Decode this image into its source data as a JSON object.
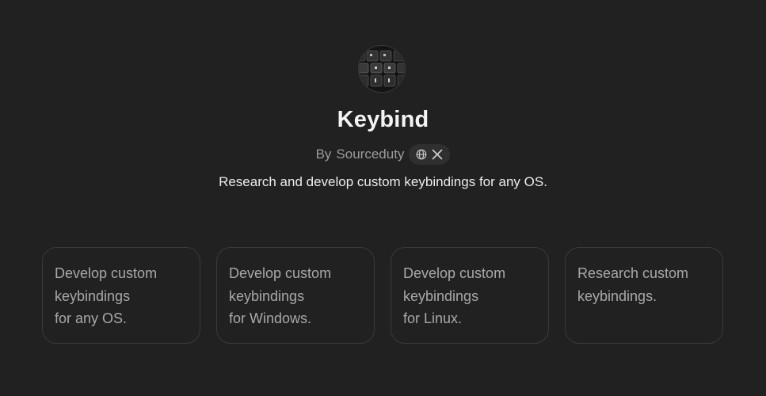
{
  "gpt": {
    "name": "Keybind",
    "author_prefix": "By",
    "author": "Sourceduty",
    "description": "Research and develop custom keybindings for any OS.",
    "links": [
      {
        "icon": "globe-icon"
      },
      {
        "icon": "x-logo-icon"
      }
    ]
  },
  "starters": [
    {
      "lines": [
        "Develop custom",
        "keybindings",
        "for any OS."
      ]
    },
    {
      "lines": [
        "Develop custom",
        "keybindings",
        "for Windows."
      ]
    },
    {
      "lines": [
        "Develop custom",
        "keybindings",
        "for Linux."
      ]
    },
    {
      "lines": [
        "Research custom",
        "keybindings."
      ]
    }
  ],
  "colors": {
    "background": "#212121",
    "card_border": "#3a3a3a",
    "muted_text": "#9b9b9b"
  }
}
